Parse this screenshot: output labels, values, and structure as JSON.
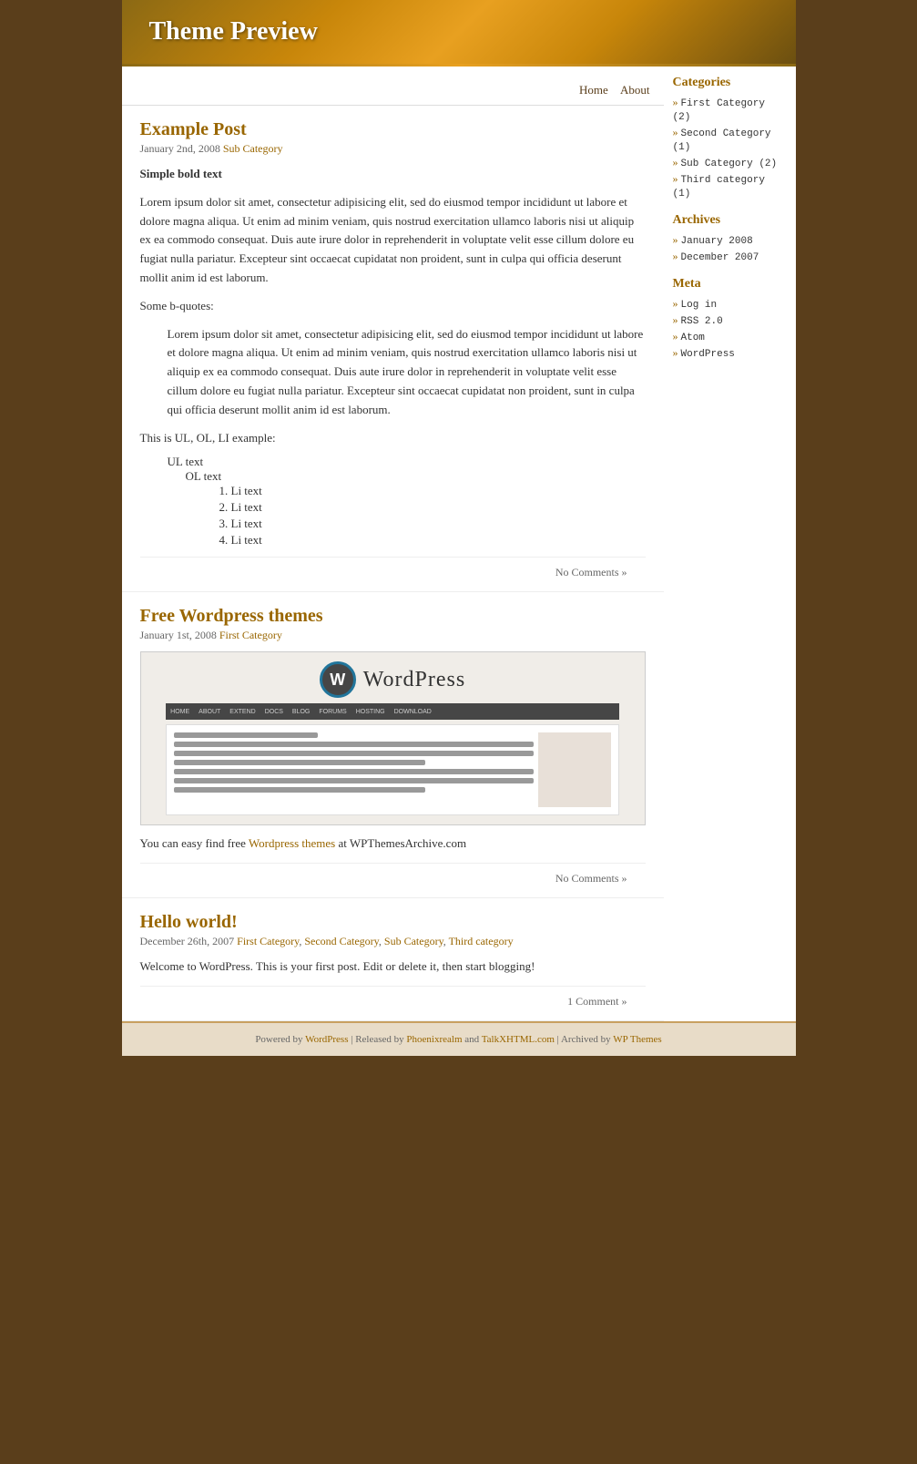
{
  "header": {
    "title": "Theme Preview"
  },
  "nav": {
    "home_label": "Home",
    "about_label": "About"
  },
  "posts": [
    {
      "title": "Example Post",
      "title_href": "#",
      "meta_date": "January 2nd, 2008",
      "meta_category": "Sub Category",
      "bold_heading": "Simple bold text",
      "paragraph": "Lorem ipsum dolor sit amet, consectetur adipisicing elit, sed do eiusmod tempor incididunt ut labore et dolore magna aliqua. Ut enim ad minim veniam, quis nostrud exercitation ullamco laboris nisi ut aliquip ex ea commodo consequat. Duis aute irure dolor in reprehenderit in voluptate velit esse cillum dolore eu fugiat nulla pariatur. Excepteur sint occaecat cupidatat non proident, sunt in culpa qui officia deserunt mollit anim id est laborum.",
      "some_bquotes_label": "Some b-quotes:",
      "blockquote": "Lorem ipsum dolor sit amet, consectetur adipisicing elit, sed do eiusmod tempor incididunt ut labore et dolore magna aliqua. Ut enim ad minim veniam, quis nostrud exercitation ullamco laboris nisi ut aliquip ex ea commodo consequat. Duis aute irure dolor in reprehenderit in voluptate velit esse cillum dolore eu fugiat nulla pariatur. Excepteur sint occaecat cupidatat non proident, sunt in culpa qui officia deserunt mollit anim id est laborum.",
      "ul_ol_label": "This is UL, OL, LI example:",
      "ul_text": "UL text",
      "ol_label": "OL text",
      "li_items": [
        "Li text",
        "Li text",
        "Li text",
        "Li text"
      ],
      "no_comments": "No Comments »"
    },
    {
      "title": "Free Wordpress themes",
      "title_href": "#",
      "meta_date": "January 1st, 2008",
      "meta_category": "First Category",
      "image_alt": "WordPress screenshot",
      "post_text_prefix": "You can easy find free ",
      "post_link_text": "Wordpress themes",
      "post_text_suffix": " at WPThemesArchive.com",
      "no_comments": "No Comments »"
    },
    {
      "title": "Hello world!",
      "title_href": "#",
      "meta_date": "December 26th, 2007",
      "meta_categories": [
        "First Category",
        "Second Category",
        "Sub Category",
        "Third category"
      ],
      "content": "Welcome to WordPress. This is your first post. Edit or delete it, then start blogging!",
      "comment_link": "1 Comment »"
    }
  ],
  "sidebar": {
    "categories_title": "Categories",
    "categories": [
      {
        "label": "First Category (2)",
        "href": "#"
      },
      {
        "label": "Second Category (1)",
        "href": "#"
      },
      {
        "label": "Sub Category (2)",
        "href": "#"
      },
      {
        "label": "Third category (1)",
        "href": "#"
      }
    ],
    "archives_title": "Archives",
    "archives": [
      {
        "label": "January 2008",
        "href": "#"
      },
      {
        "label": "December 2007",
        "href": "#"
      }
    ],
    "meta_title": "Meta",
    "meta_links": [
      {
        "label": "Log in",
        "href": "#"
      },
      {
        "label": "RSS 2.0",
        "href": "#"
      },
      {
        "label": "Atom",
        "href": "#"
      },
      {
        "label": "WordPress",
        "href": "#"
      }
    ]
  },
  "footer": {
    "powered_by_prefix": "Powered by ",
    "powered_by_link": "WordPress",
    "released_by_prefix": " | Released by ",
    "released_by_link": "Phoenixrealm",
    "and_text": " and ",
    "talk_link": "TalkXHTML.com",
    "archived_prefix": " | Archived by ",
    "archived_link": "WP Themes"
  }
}
